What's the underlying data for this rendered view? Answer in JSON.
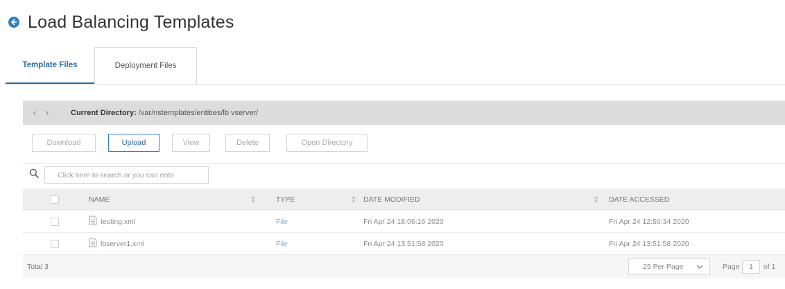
{
  "header": {
    "title": "Load Balancing Templates",
    "back_icon": "back-arrow-circle-icon"
  },
  "tabs": [
    {
      "label": "Template Files",
      "active": true
    },
    {
      "label": "Deployment Files",
      "active": false
    }
  ],
  "directory": {
    "label": "Current Directory:",
    "path": "/var/nstemplates/entities/lb vserver/"
  },
  "toolbar": {
    "download": "Download",
    "upload": "Upload",
    "view": "View",
    "delete": "Delete",
    "open_directory": "Open Directory"
  },
  "search": {
    "placeholder": "Click here to search or you can ente"
  },
  "table": {
    "columns": [
      "NAME",
      "TYPE",
      "DATE MODIFIED",
      "DATE ACCESSED"
    ],
    "rows": [
      {
        "name": "testing.xml",
        "type": "File",
        "modified": "Fri Apr 24 18:06:16 2020",
        "accessed": "Fri Apr 24 12:50:34 2020"
      },
      {
        "name": "lbserver1.xml",
        "type": "File",
        "modified": "Fri Apr 24 13:51:58 2020",
        "accessed": "Fri Apr 24 13:51:58 2020"
      }
    ]
  },
  "footer": {
    "total": "Total 3",
    "per_page": "25 Per Page",
    "page_label": "Page",
    "page_value": "1",
    "page_of": "of 1"
  },
  "colors": {
    "accent": "#2f7fc1",
    "dir_bar": "#dcdcdc",
    "header_row": "#eeeeee"
  }
}
